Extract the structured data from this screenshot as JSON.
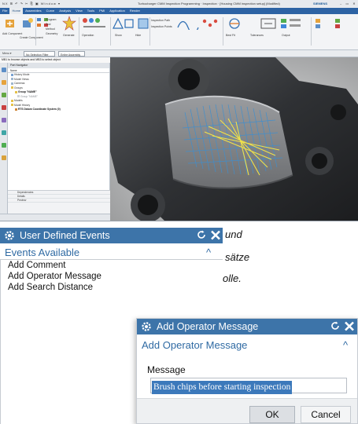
{
  "nx_window": {
    "title_quick_access": "NX  ⊞  ↶  ↷  ✂  ⎘  ▣  Window ▾",
    "title": "Turbocharger CMM Inspection Programming · Inspection · [Housing CMM inspection setup] (Modified)",
    "brand": "SIEMENS",
    "window_controls": "– ▭ ✕",
    "menu": [
      "File",
      "Home",
      "Assemblies",
      "Curve",
      "Analysis",
      "View",
      "Tools",
      "PMI",
      "Application",
      "Render"
    ],
    "active_menu": "Home",
    "ribbon_labels": [
      "Add Component",
      "Create Component",
      "Program",
      "Tool",
      "Method",
      "Geometry",
      "Generate",
      "Operation",
      "Show",
      "Hide",
      "Inspection Path",
      "Inspection Points",
      "Best Fit",
      "Tolerances",
      "Output"
    ],
    "filter_menu_label": "Menu ▾",
    "filter_text": "No Selection Filter",
    "scope_text": "Entire Assembly",
    "hint": "MB1 to browse objects and MB3 to select object",
    "navigator": {
      "header": "Part Navigator",
      "column": "Name",
      "rows": [
        "History Mode",
        "Model Views",
        "Cameras",
        "Groups",
        "Group \"NAME\"",
        "Group \"NAME\"",
        "Models",
        "Model History",
        "RTS Datum Coordinate System (0)"
      ],
      "lower_rows": [
        "Dependencies",
        "Details",
        "Preview"
      ]
    }
  },
  "background_text": {
    "line1": "und",
    "line2": "sätze",
    "line3": "olle."
  },
  "dialog_events": {
    "title": "User Defined Events",
    "group_label": "Events Available",
    "items": [
      "Add Comment",
      "Add Operator Message",
      "Add Search Distance"
    ]
  },
  "dialog_message": {
    "title": "Add Operator Message",
    "group_label": "Add Operator Message",
    "field_label": "Message",
    "field_value": "Brush chips before starting inspection",
    "ok_label": "OK",
    "cancel_label": "Cancel"
  },
  "icons": [
    "gear-icon",
    "reset-icon",
    "close-icon",
    "collapse-caret-icon",
    "pointer-arrow-icon"
  ],
  "colors": {
    "dialog_title_bar": "#3d74a9",
    "group_label": "#2f6aa3",
    "selection": "#3c79bb",
    "menu_bar": "#2d63a4",
    "close_icon": "#ffffff"
  }
}
